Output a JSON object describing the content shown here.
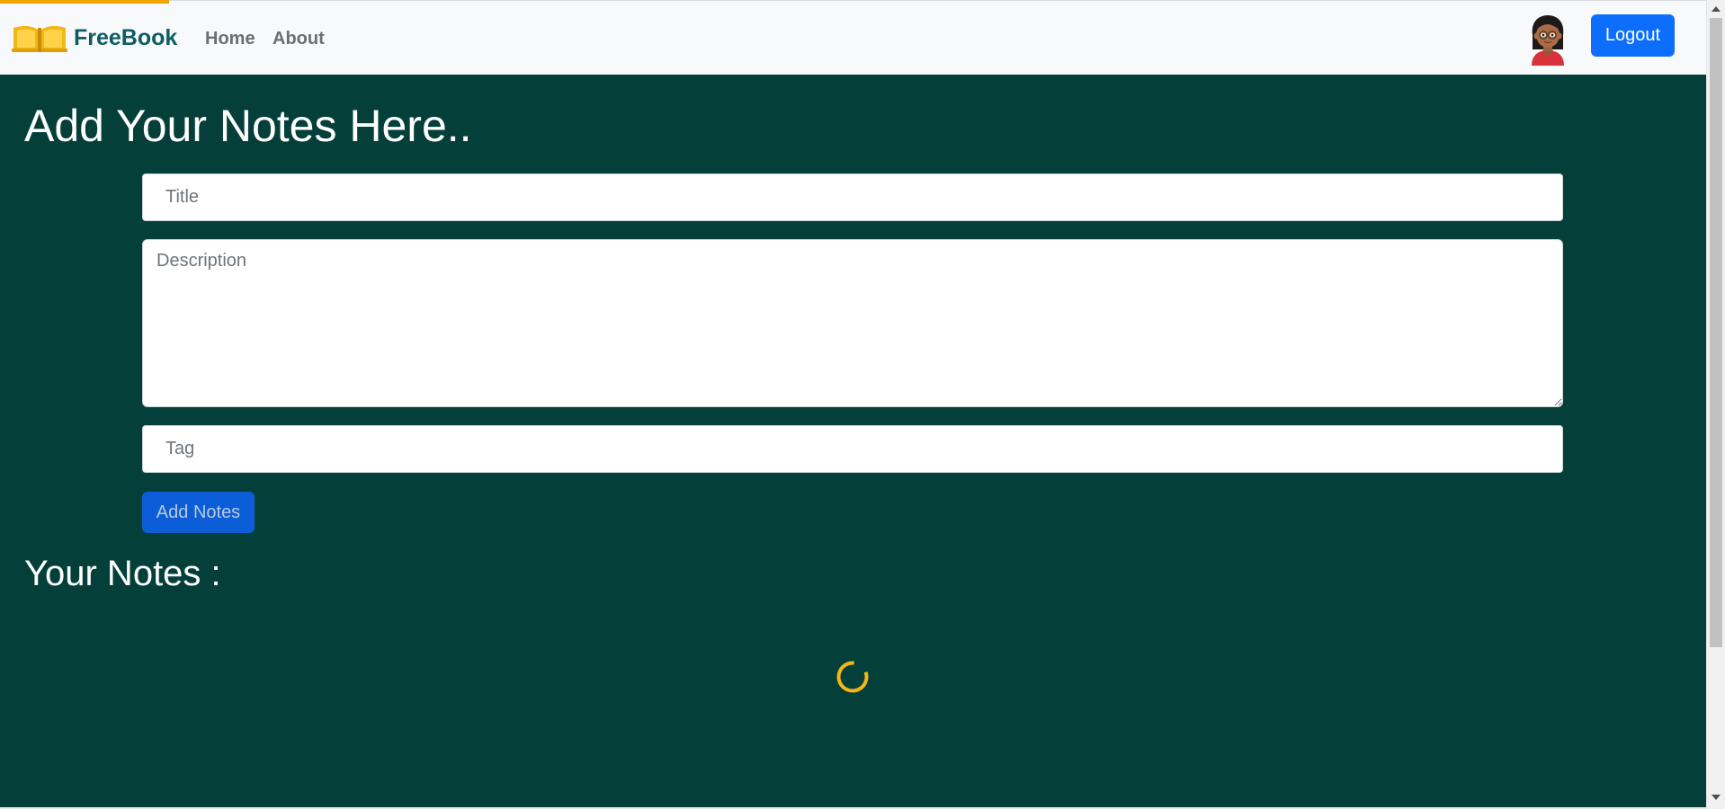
{
  "navbar": {
    "brand_name": "FreeBook",
    "links": [
      {
        "label": "Home"
      },
      {
        "label": "About"
      }
    ],
    "logout_label": "Logout"
  },
  "main": {
    "heading": "Add Your Notes Here..",
    "form": {
      "title": {
        "value": "",
        "placeholder": "Title"
      },
      "description": {
        "value": "",
        "placeholder": "Description"
      },
      "tag": {
        "value": "",
        "placeholder": "Tag"
      },
      "submit_label": "Add Notes"
    },
    "notes_heading": "Your Notes :",
    "loading": true
  },
  "colors": {
    "page_background": "#043f3a",
    "navbar_background": "#f8f9fa",
    "brand_text": "#0d5c63",
    "brand_icon": "#f2b713",
    "primary_button": "#0d6efd",
    "add_button": "#0b5ed7",
    "spinner": "#f2b713",
    "progress_line": "#f0a500"
  },
  "icons": {
    "brand": "open-book-icon",
    "avatar": "user-avatar-icon",
    "loading": "loading-spinner-icon"
  },
  "top_progress_fraction": 0.098
}
